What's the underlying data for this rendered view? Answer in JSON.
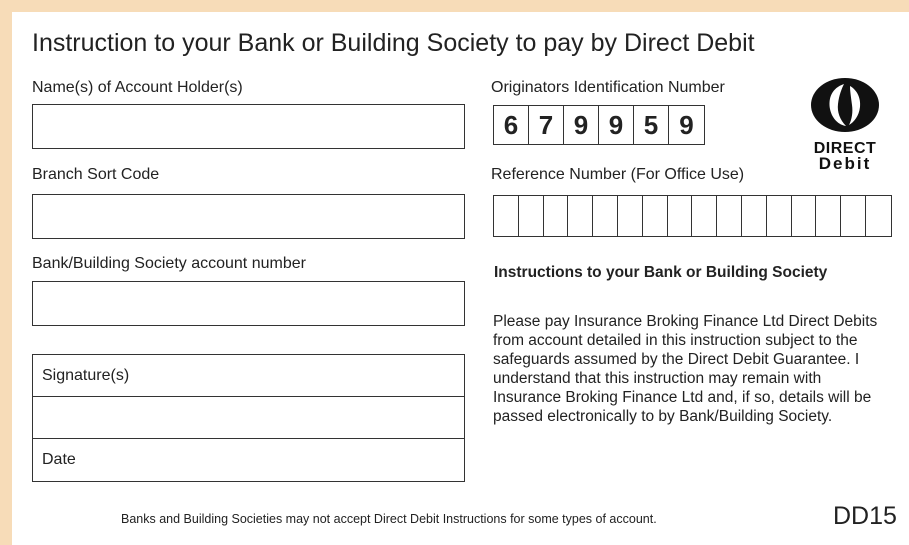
{
  "title": "Instruction to your Bank or Building Society to pay by Direct Debit",
  "fields": {
    "account_holder_label": "Name(s) of Account Holder(s)",
    "sort_code_label": "Branch Sort Code",
    "account_number_label": "Bank/Building Society account number"
  },
  "signature_box": {
    "signature_label": "Signature(s)",
    "date_label": "Date"
  },
  "originator": {
    "label": "Originators Identification Number",
    "digits": [
      "6",
      "7",
      "9",
      "9",
      "5",
      "9"
    ]
  },
  "reference": {
    "label": "Reference Number (For Office Use)",
    "cells": 16
  },
  "logo": {
    "line1": "DIRECT",
    "line2": "Debit"
  },
  "instructions": {
    "heading": "Instructions to your Bank or Building Society",
    "body": "Please pay Insurance Broking Finance Ltd Direct Debits from account detailed in this instruction subject to the safeguards assumed by the Direct Debit Guarantee. I understand that this instruction may remain with Insurance Broking Finance Ltd and, if so, details will be passed electronically to by Bank/Building Society."
  },
  "footer": {
    "note": "Banks and Building Societies may not accept Direct Debit Instructions for some types of account.",
    "code": "DD15"
  }
}
